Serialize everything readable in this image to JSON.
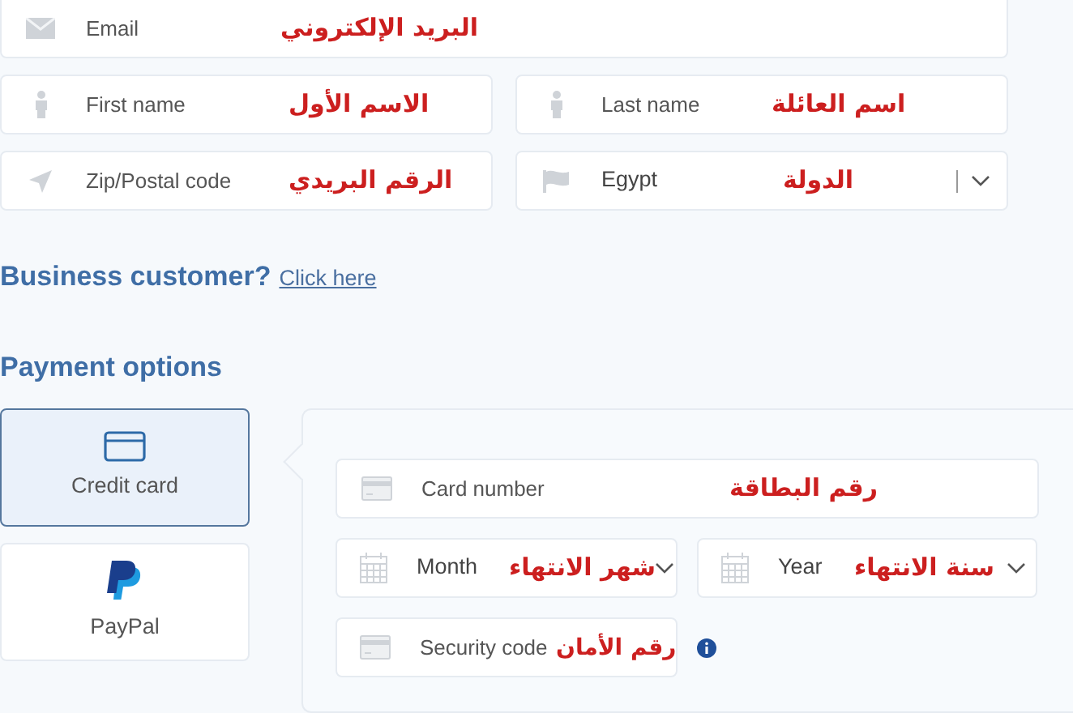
{
  "email": {
    "placeholder": "Email",
    "annotation": "البريد الإلكتروني"
  },
  "first_name": {
    "placeholder": "First name",
    "annotation": "الاسم الأول"
  },
  "last_name": {
    "placeholder": "Last name",
    "annotation": "اسم العائلة"
  },
  "postal_code": {
    "placeholder": "Zip/Postal code",
    "annotation": "الرقم البريدي"
  },
  "country": {
    "value": "Egypt",
    "annotation": "الدولة"
  },
  "business": {
    "question": "Business customer?",
    "link": "Click here"
  },
  "payment": {
    "heading": "Payment options",
    "methods": [
      {
        "kind": "card",
        "label": "Credit card",
        "selected": true
      },
      {
        "kind": "paypal",
        "label": "PayPal",
        "selected": false
      }
    ],
    "card_number": {
      "placeholder": "Card number",
      "annotation": "رقم البطاقة"
    },
    "month": {
      "placeholder": "Month",
      "annotation": "شهر الانتهاء"
    },
    "year": {
      "placeholder": "Year",
      "annotation": "سنة الانتهاء"
    },
    "security_code": {
      "placeholder": "Security code",
      "annotation": "رقم الأمان"
    }
  }
}
